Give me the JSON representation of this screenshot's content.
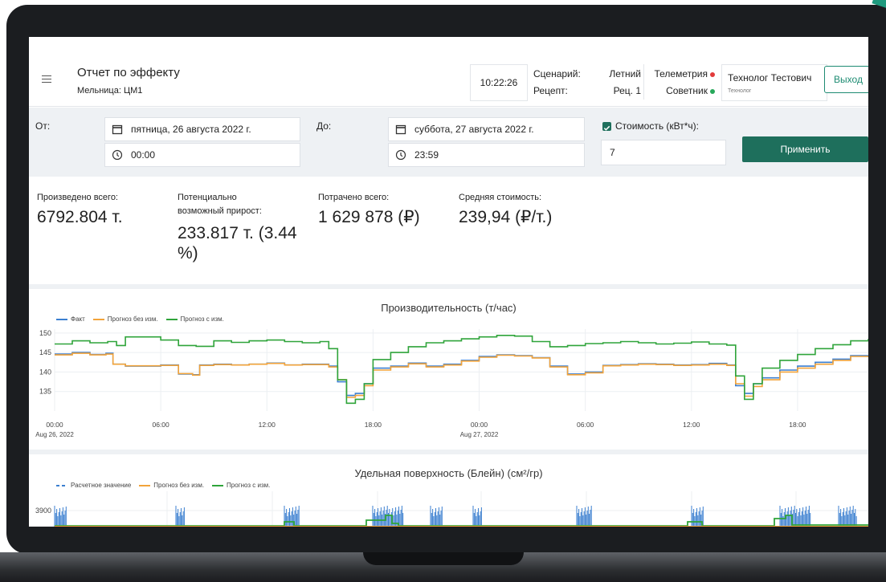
{
  "header": {
    "title": "Отчет по эффекту",
    "subtitle": "Мельница: ЦМ1",
    "time": "10:22:26",
    "scenario_label": "Сценарий:",
    "scenario_value": "Летний",
    "recipe_label": "Рецепт:",
    "recipe_value": "Рец. 1",
    "telemetry_label": "Телеметрия",
    "advisor_label": "Советник",
    "user_name": "Технолог Тестович",
    "user_role": "Технолог",
    "logout_label": "Выход"
  },
  "status_colors": {
    "telemetry": "#e23b3b",
    "advisor": "#27a85a"
  },
  "filters": {
    "from_label": "От:",
    "from_date": "пятница, 26 августа 2022 г.",
    "from_time": "00:00",
    "to_label": "До:",
    "to_date": "суббота, 27 августа 2022 г.",
    "to_time": "23:59",
    "cost_checkbox_label": "Стоимость (кВт*ч):",
    "cost_checked": true,
    "cost_value": "7",
    "apply_label": "Применить"
  },
  "stats": {
    "produced_label": "Произведено всего:",
    "produced_value": "6792.804 т.",
    "potential_label_1": "Потенциально",
    "potential_label_2": "возможный прирост:",
    "potential_value_1": "233.817 т. (3.44",
    "potential_value_2": "%)",
    "spent_label": "Потрачено всего:",
    "spent_value": "1 629 878 (₽)",
    "avg_label": "Средняя стоимость:",
    "avg_value": "239,94 (₽/т.)"
  },
  "colors": {
    "accent": "#1e6f5c",
    "fact": "#3b7fd0",
    "forecast_no_change": "#f2a33a",
    "forecast_with_change": "#2fa43a"
  },
  "chart_data": [
    {
      "type": "line",
      "title": "Производительность (т/час)",
      "legend": [
        "Факт",
        "Прогноз без изм.",
        "Прогноз с изм."
      ],
      "legend_placement": "top-left",
      "ylim": [
        130,
        151
      ],
      "yticks": [
        135,
        140,
        145,
        150
      ],
      "xlim": [
        0,
        46
      ],
      "xticks": [
        {
          "x": 0,
          "label": "00:00",
          "sublabel": "Aug 26, 2022"
        },
        {
          "x": 6,
          "label": "06:00",
          "sublabel": ""
        },
        {
          "x": 12,
          "label": "12:00",
          "sublabel": ""
        },
        {
          "x": 18,
          "label": "18:00",
          "sublabel": ""
        },
        {
          "x": 24,
          "label": "00:00",
          "sublabel": "Aug 27, 2022"
        },
        {
          "x": 30,
          "label": "06:00",
          "sublabel": ""
        },
        {
          "x": 36,
          "label": "12:00",
          "sublabel": ""
        },
        {
          "x": 42,
          "label": "18:00",
          "sublabel": ""
        }
      ],
      "grid": true,
      "series": [
        {
          "name": "Факт",
          "color": "#3b7fd0",
          "x": [
            0,
            1,
            2,
            2.9,
            3.3,
            4,
            6,
            7,
            7.8,
            8.2,
            9,
            10,
            11,
            12,
            13,
            14,
            15,
            15.5,
            16,
            16.5,
            17,
            17.5,
            18,
            19,
            20,
            21,
            22,
            23,
            24,
            25,
            26,
            27,
            28,
            29,
            30,
            31,
            32,
            33,
            34,
            35,
            36,
            37,
            38,
            38.5,
            39,
            39.5,
            40,
            41,
            42,
            43,
            44,
            45,
            46
          ],
          "y": [
            144.6,
            145,
            144.5,
            144.8,
            142,
            141.5,
            141.8,
            139.5,
            139.3,
            141.8,
            142,
            141.8,
            142,
            142.3,
            141.8,
            142,
            142,
            141.5,
            137.5,
            134,
            134.5,
            137,
            141,
            141.5,
            142.3,
            141.5,
            142,
            143,
            144,
            144.4,
            144.2,
            143.7,
            141.5,
            139.5,
            140,
            141.7,
            141.9,
            142.1,
            142,
            141.8,
            141.9,
            142.2,
            141.8,
            136.5,
            134.5,
            137,
            138.5,
            140.5,
            141.5,
            142.5,
            143.3,
            144.2,
            144
          ]
        },
        {
          "name": "Прогноз без изм.",
          "color": "#f2a33a",
          "x": [
            0,
            1,
            2,
            2.9,
            3.3,
            4,
            6,
            7,
            7.8,
            8.2,
            9,
            10,
            11,
            12,
            13,
            14,
            15,
            15.5,
            16,
            16.5,
            17,
            17.5,
            18,
            19,
            20,
            21,
            22,
            23,
            24,
            25,
            26,
            27,
            28,
            29,
            30,
            31,
            32,
            33,
            34,
            35,
            36,
            37,
            38,
            38.5,
            39,
            39.5,
            40,
            41,
            42,
            43,
            44,
            45,
            46
          ],
          "y": [
            144.4,
            144.8,
            144.4,
            144.6,
            142,
            141.6,
            141.7,
            139.6,
            139.2,
            141.7,
            141.9,
            141.8,
            142,
            142.2,
            141.8,
            141.9,
            141.9,
            141.3,
            138,
            133.5,
            134,
            136.5,
            140.5,
            141.3,
            142.1,
            141.3,
            141.8,
            142.8,
            143.8,
            144.3,
            144.1,
            143.6,
            141.3,
            139.3,
            139.8,
            141.6,
            141.8,
            142,
            141.9,
            141.7,
            141.8,
            142,
            141.7,
            137,
            133.8,
            136.3,
            138,
            140,
            141,
            142,
            143,
            144,
            143.8
          ]
        },
        {
          "name": "Прогноз с изм.",
          "color": "#2fa43a",
          "x": [
            0,
            1,
            2,
            3,
            3.5,
            4,
            6,
            7,
            8,
            9,
            10,
            11,
            12,
            13,
            14,
            15,
            15.5,
            16,
            16.5,
            17,
            17.5,
            18,
            19,
            20,
            21,
            22,
            23,
            24,
            25,
            26,
            27,
            28,
            29,
            30,
            31,
            32,
            33,
            34,
            35,
            36,
            37,
            38,
            38.5,
            39,
            39.5,
            40,
            41,
            42,
            43,
            44,
            45,
            46
          ],
          "y": [
            147.2,
            148,
            147.5,
            147.8,
            146.8,
            149,
            148.2,
            146.8,
            146.6,
            148,
            147.6,
            148,
            148.2,
            147.8,
            147.5,
            147.8,
            146,
            138,
            132,
            133,
            137,
            143.2,
            145,
            146.5,
            147.5,
            148,
            148.5,
            149,
            149.4,
            149.2,
            147.8,
            146.5,
            146.8,
            147.3,
            147.5,
            147.8,
            147.5,
            147.2,
            147.4,
            147.7,
            147.2,
            146.9,
            139,
            133,
            137,
            141,
            143,
            144.5,
            146,
            147,
            148,
            148.5
          ]
        }
      ]
    },
    {
      "type": "line",
      "title": "Удельная поверхность (Блейн) (см²/гр)",
      "legend": [
        "Расчетное значение",
        "Прогноз без изм.",
        "Прогноз с изм."
      ],
      "legend_placement": "top-left",
      "yticks": [
        3900
      ],
      "grid": true,
      "series": [
        {
          "name": "Расчетное значение",
          "color": "#3b7fd0",
          "dashed": true
        },
        {
          "name": "Прогноз без изм.",
          "color": "#f2a33a"
        },
        {
          "name": "Прогноз с изм.",
          "color": "#2fa43a"
        }
      ]
    }
  ]
}
